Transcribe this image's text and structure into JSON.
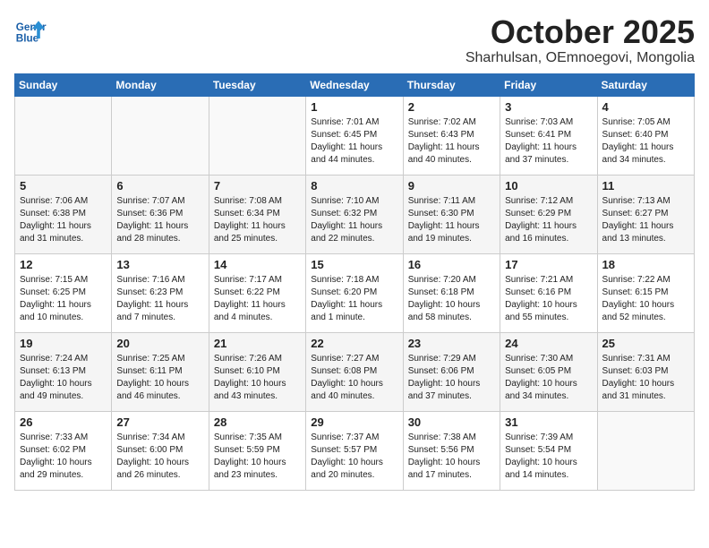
{
  "header": {
    "logo_line1": "General",
    "logo_line2": "Blue",
    "month": "October 2025",
    "location": "Sharhulsan, OEmnoegovi, Mongolia"
  },
  "days_of_week": [
    "Sunday",
    "Monday",
    "Tuesday",
    "Wednesday",
    "Thursday",
    "Friday",
    "Saturday"
  ],
  "weeks": [
    [
      {
        "day": "",
        "content": ""
      },
      {
        "day": "",
        "content": ""
      },
      {
        "day": "",
        "content": ""
      },
      {
        "day": "1",
        "content": "Sunrise: 7:01 AM\nSunset: 6:45 PM\nDaylight: 11 hours\nand 44 minutes."
      },
      {
        "day": "2",
        "content": "Sunrise: 7:02 AM\nSunset: 6:43 PM\nDaylight: 11 hours\nand 40 minutes."
      },
      {
        "day": "3",
        "content": "Sunrise: 7:03 AM\nSunset: 6:41 PM\nDaylight: 11 hours\nand 37 minutes."
      },
      {
        "day": "4",
        "content": "Sunrise: 7:05 AM\nSunset: 6:40 PM\nDaylight: 11 hours\nand 34 minutes."
      }
    ],
    [
      {
        "day": "5",
        "content": "Sunrise: 7:06 AM\nSunset: 6:38 PM\nDaylight: 11 hours\nand 31 minutes."
      },
      {
        "day": "6",
        "content": "Sunrise: 7:07 AM\nSunset: 6:36 PM\nDaylight: 11 hours\nand 28 minutes."
      },
      {
        "day": "7",
        "content": "Sunrise: 7:08 AM\nSunset: 6:34 PM\nDaylight: 11 hours\nand 25 minutes."
      },
      {
        "day": "8",
        "content": "Sunrise: 7:10 AM\nSunset: 6:32 PM\nDaylight: 11 hours\nand 22 minutes."
      },
      {
        "day": "9",
        "content": "Sunrise: 7:11 AM\nSunset: 6:30 PM\nDaylight: 11 hours\nand 19 minutes."
      },
      {
        "day": "10",
        "content": "Sunrise: 7:12 AM\nSunset: 6:29 PM\nDaylight: 11 hours\nand 16 minutes."
      },
      {
        "day": "11",
        "content": "Sunrise: 7:13 AM\nSunset: 6:27 PM\nDaylight: 11 hours\nand 13 minutes."
      }
    ],
    [
      {
        "day": "12",
        "content": "Sunrise: 7:15 AM\nSunset: 6:25 PM\nDaylight: 11 hours\nand 10 minutes."
      },
      {
        "day": "13",
        "content": "Sunrise: 7:16 AM\nSunset: 6:23 PM\nDaylight: 11 hours\nand 7 minutes."
      },
      {
        "day": "14",
        "content": "Sunrise: 7:17 AM\nSunset: 6:22 PM\nDaylight: 11 hours\nand 4 minutes."
      },
      {
        "day": "15",
        "content": "Sunrise: 7:18 AM\nSunset: 6:20 PM\nDaylight: 11 hours\nand 1 minute."
      },
      {
        "day": "16",
        "content": "Sunrise: 7:20 AM\nSunset: 6:18 PM\nDaylight: 10 hours\nand 58 minutes."
      },
      {
        "day": "17",
        "content": "Sunrise: 7:21 AM\nSunset: 6:16 PM\nDaylight: 10 hours\nand 55 minutes."
      },
      {
        "day": "18",
        "content": "Sunrise: 7:22 AM\nSunset: 6:15 PM\nDaylight: 10 hours\nand 52 minutes."
      }
    ],
    [
      {
        "day": "19",
        "content": "Sunrise: 7:24 AM\nSunset: 6:13 PM\nDaylight: 10 hours\nand 49 minutes."
      },
      {
        "day": "20",
        "content": "Sunrise: 7:25 AM\nSunset: 6:11 PM\nDaylight: 10 hours\nand 46 minutes."
      },
      {
        "day": "21",
        "content": "Sunrise: 7:26 AM\nSunset: 6:10 PM\nDaylight: 10 hours\nand 43 minutes."
      },
      {
        "day": "22",
        "content": "Sunrise: 7:27 AM\nSunset: 6:08 PM\nDaylight: 10 hours\nand 40 minutes."
      },
      {
        "day": "23",
        "content": "Sunrise: 7:29 AM\nSunset: 6:06 PM\nDaylight: 10 hours\nand 37 minutes."
      },
      {
        "day": "24",
        "content": "Sunrise: 7:30 AM\nSunset: 6:05 PM\nDaylight: 10 hours\nand 34 minutes."
      },
      {
        "day": "25",
        "content": "Sunrise: 7:31 AM\nSunset: 6:03 PM\nDaylight: 10 hours\nand 31 minutes."
      }
    ],
    [
      {
        "day": "26",
        "content": "Sunrise: 7:33 AM\nSunset: 6:02 PM\nDaylight: 10 hours\nand 29 minutes."
      },
      {
        "day": "27",
        "content": "Sunrise: 7:34 AM\nSunset: 6:00 PM\nDaylight: 10 hours\nand 26 minutes."
      },
      {
        "day": "28",
        "content": "Sunrise: 7:35 AM\nSunset: 5:59 PM\nDaylight: 10 hours\nand 23 minutes."
      },
      {
        "day": "29",
        "content": "Sunrise: 7:37 AM\nSunset: 5:57 PM\nDaylight: 10 hours\nand 20 minutes."
      },
      {
        "day": "30",
        "content": "Sunrise: 7:38 AM\nSunset: 5:56 PM\nDaylight: 10 hours\nand 17 minutes."
      },
      {
        "day": "31",
        "content": "Sunrise: 7:39 AM\nSunset: 5:54 PM\nDaylight: 10 hours\nand 14 minutes."
      },
      {
        "day": "",
        "content": ""
      }
    ]
  ]
}
